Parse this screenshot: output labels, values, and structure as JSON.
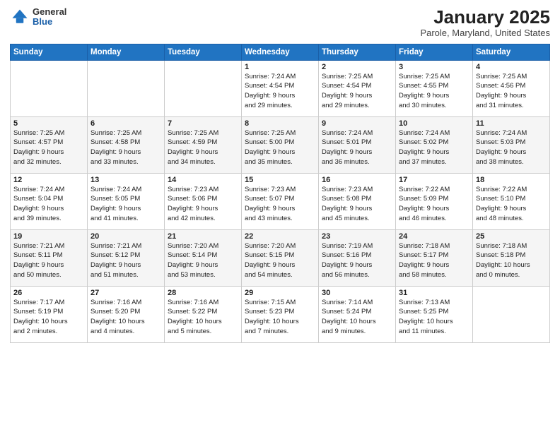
{
  "logo": {
    "general": "General",
    "blue": "Blue"
  },
  "title": "January 2025",
  "subtitle": "Parole, Maryland, United States",
  "days_header": [
    "Sunday",
    "Monday",
    "Tuesday",
    "Wednesday",
    "Thursday",
    "Friday",
    "Saturday"
  ],
  "weeks": [
    [
      {
        "num": "",
        "info": ""
      },
      {
        "num": "",
        "info": ""
      },
      {
        "num": "",
        "info": ""
      },
      {
        "num": "1",
        "info": "Sunrise: 7:24 AM\nSunset: 4:54 PM\nDaylight: 9 hours\nand 29 minutes."
      },
      {
        "num": "2",
        "info": "Sunrise: 7:25 AM\nSunset: 4:54 PM\nDaylight: 9 hours\nand 29 minutes."
      },
      {
        "num": "3",
        "info": "Sunrise: 7:25 AM\nSunset: 4:55 PM\nDaylight: 9 hours\nand 30 minutes."
      },
      {
        "num": "4",
        "info": "Sunrise: 7:25 AM\nSunset: 4:56 PM\nDaylight: 9 hours\nand 31 minutes."
      }
    ],
    [
      {
        "num": "5",
        "info": "Sunrise: 7:25 AM\nSunset: 4:57 PM\nDaylight: 9 hours\nand 32 minutes."
      },
      {
        "num": "6",
        "info": "Sunrise: 7:25 AM\nSunset: 4:58 PM\nDaylight: 9 hours\nand 33 minutes."
      },
      {
        "num": "7",
        "info": "Sunrise: 7:25 AM\nSunset: 4:59 PM\nDaylight: 9 hours\nand 34 minutes."
      },
      {
        "num": "8",
        "info": "Sunrise: 7:25 AM\nSunset: 5:00 PM\nDaylight: 9 hours\nand 35 minutes."
      },
      {
        "num": "9",
        "info": "Sunrise: 7:24 AM\nSunset: 5:01 PM\nDaylight: 9 hours\nand 36 minutes."
      },
      {
        "num": "10",
        "info": "Sunrise: 7:24 AM\nSunset: 5:02 PM\nDaylight: 9 hours\nand 37 minutes."
      },
      {
        "num": "11",
        "info": "Sunrise: 7:24 AM\nSunset: 5:03 PM\nDaylight: 9 hours\nand 38 minutes."
      }
    ],
    [
      {
        "num": "12",
        "info": "Sunrise: 7:24 AM\nSunset: 5:04 PM\nDaylight: 9 hours\nand 39 minutes."
      },
      {
        "num": "13",
        "info": "Sunrise: 7:24 AM\nSunset: 5:05 PM\nDaylight: 9 hours\nand 41 minutes."
      },
      {
        "num": "14",
        "info": "Sunrise: 7:23 AM\nSunset: 5:06 PM\nDaylight: 9 hours\nand 42 minutes."
      },
      {
        "num": "15",
        "info": "Sunrise: 7:23 AM\nSunset: 5:07 PM\nDaylight: 9 hours\nand 43 minutes."
      },
      {
        "num": "16",
        "info": "Sunrise: 7:23 AM\nSunset: 5:08 PM\nDaylight: 9 hours\nand 45 minutes."
      },
      {
        "num": "17",
        "info": "Sunrise: 7:22 AM\nSunset: 5:09 PM\nDaylight: 9 hours\nand 46 minutes."
      },
      {
        "num": "18",
        "info": "Sunrise: 7:22 AM\nSunset: 5:10 PM\nDaylight: 9 hours\nand 48 minutes."
      }
    ],
    [
      {
        "num": "19",
        "info": "Sunrise: 7:21 AM\nSunset: 5:11 PM\nDaylight: 9 hours\nand 50 minutes."
      },
      {
        "num": "20",
        "info": "Sunrise: 7:21 AM\nSunset: 5:12 PM\nDaylight: 9 hours\nand 51 minutes."
      },
      {
        "num": "21",
        "info": "Sunrise: 7:20 AM\nSunset: 5:14 PM\nDaylight: 9 hours\nand 53 minutes."
      },
      {
        "num": "22",
        "info": "Sunrise: 7:20 AM\nSunset: 5:15 PM\nDaylight: 9 hours\nand 54 minutes."
      },
      {
        "num": "23",
        "info": "Sunrise: 7:19 AM\nSunset: 5:16 PM\nDaylight: 9 hours\nand 56 minutes."
      },
      {
        "num": "24",
        "info": "Sunrise: 7:18 AM\nSunset: 5:17 PM\nDaylight: 9 hours\nand 58 minutes."
      },
      {
        "num": "25",
        "info": "Sunrise: 7:18 AM\nSunset: 5:18 PM\nDaylight: 10 hours\nand 0 minutes."
      }
    ],
    [
      {
        "num": "26",
        "info": "Sunrise: 7:17 AM\nSunset: 5:19 PM\nDaylight: 10 hours\nand 2 minutes."
      },
      {
        "num": "27",
        "info": "Sunrise: 7:16 AM\nSunset: 5:20 PM\nDaylight: 10 hours\nand 4 minutes."
      },
      {
        "num": "28",
        "info": "Sunrise: 7:16 AM\nSunset: 5:22 PM\nDaylight: 10 hours\nand 5 minutes."
      },
      {
        "num": "29",
        "info": "Sunrise: 7:15 AM\nSunset: 5:23 PM\nDaylight: 10 hours\nand 7 minutes."
      },
      {
        "num": "30",
        "info": "Sunrise: 7:14 AM\nSunset: 5:24 PM\nDaylight: 10 hours\nand 9 minutes."
      },
      {
        "num": "31",
        "info": "Sunrise: 7:13 AM\nSunset: 5:25 PM\nDaylight: 10 hours\nand 11 minutes."
      },
      {
        "num": "",
        "info": ""
      }
    ]
  ]
}
